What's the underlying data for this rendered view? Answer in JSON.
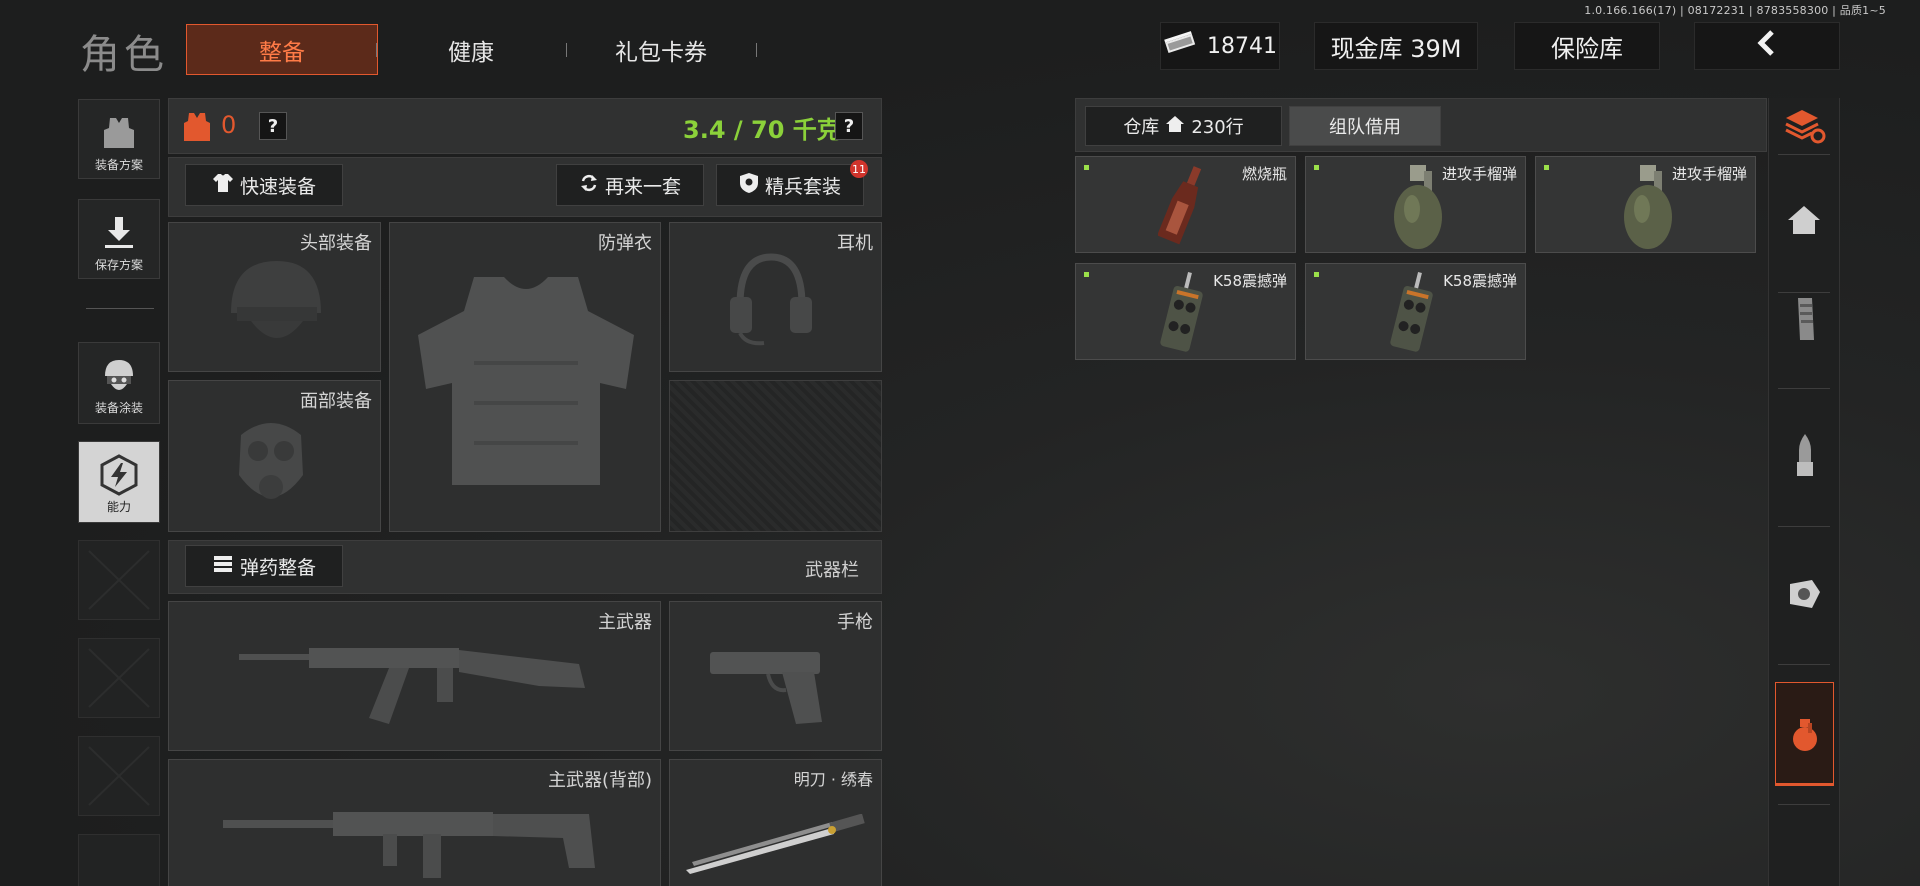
{
  "version_info": "1.0.166.166(17) | 08172231 | 8783558300 | 品质1~5",
  "header": {
    "title": "角色",
    "tabs": [
      {
        "label": "整备",
        "active": true
      },
      {
        "label": "健康",
        "active": false
      },
      {
        "label": "礼包卡券",
        "active": false
      }
    ],
    "currency_value": "18741",
    "cash_vault_label": "现金库 39M",
    "safe_box_label": "保险库"
  },
  "left_nav": {
    "items": [
      {
        "label": "装备方案"
      },
      {
        "label": "保存方案"
      },
      {
        "label": "装备涂装"
      },
      {
        "label": "能力"
      }
    ]
  },
  "loadout": {
    "armor_count": "0",
    "weight_text": "3.4 / 70 千克",
    "help_symbol": "?",
    "quick_equip_label": "快速装备",
    "repeat_label": "再来一套",
    "elite_label": "精兵套装",
    "elite_badge": "11",
    "slots": {
      "head": "头部装备",
      "vest": "防弹衣",
      "headset": "耳机",
      "face": "面部装备"
    },
    "ammo_label": "弹药整备",
    "weapon_bar_label": "武器栏",
    "weapons": {
      "primary": "主武器",
      "pistol": "手枪",
      "primary_back": "主武器(背部)",
      "melee": "明刀 · 绣春"
    }
  },
  "inventory": {
    "tabs": [
      {
        "label": "仓库",
        "count": "230行",
        "active": true
      },
      {
        "label": "组队借用",
        "active": false
      }
    ],
    "items": [
      {
        "name": "燃烧瓶",
        "icon": "molotov-icon"
      },
      {
        "name": "进攻手榴弹",
        "icon": "grenade-icon"
      },
      {
        "name": "进攻手榴弹",
        "icon": "grenade-icon"
      },
      {
        "name": "K58震撼弹",
        "icon": "flashbang-icon"
      },
      {
        "name": "K58震撼弹",
        "icon": "flashbang-icon"
      }
    ]
  },
  "colors": {
    "accent": "#e2582e",
    "weight_green": "#8bd13a",
    "rarity_dot": "#9be04a"
  }
}
